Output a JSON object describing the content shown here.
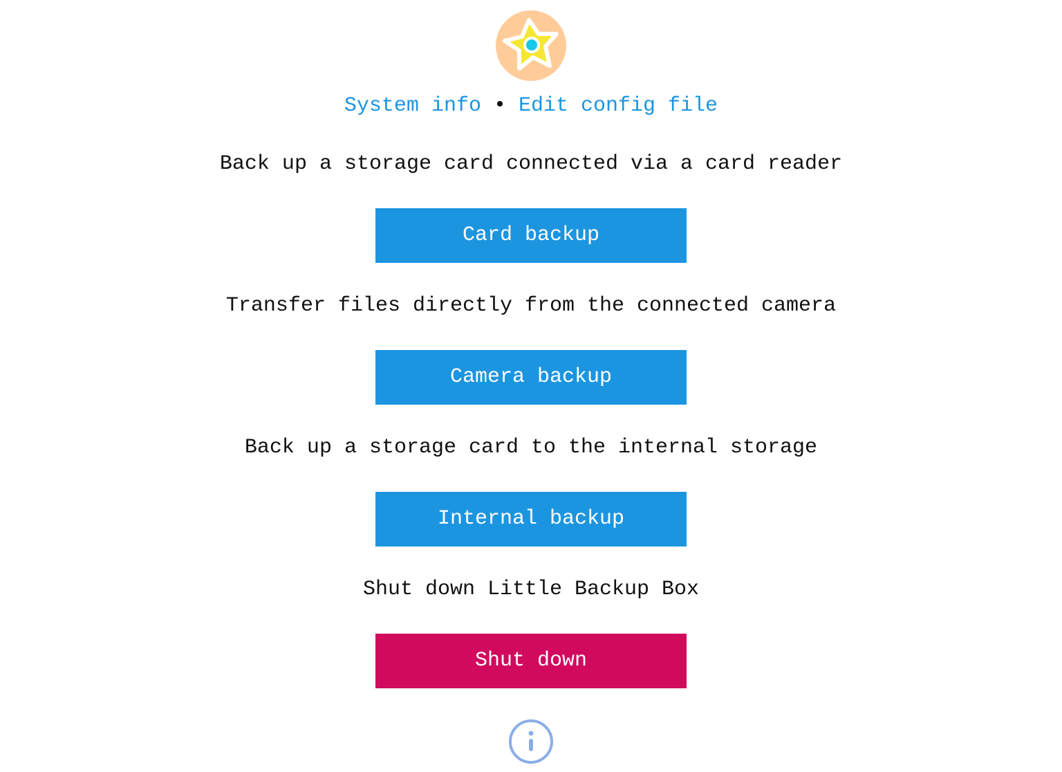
{
  "header": {
    "logo_icon": "starfish-logo-icon",
    "nav": {
      "system_info": "System info",
      "separator": "•",
      "edit_config": "Edit config file"
    }
  },
  "sections": [
    {
      "description": "Back up a storage card connected via a card reader",
      "button_label": "Card backup",
      "button_color": "#1c95e0"
    },
    {
      "description": "Transfer files directly from the connected camera",
      "button_label": "Camera backup",
      "button_color": "#1c95e0"
    },
    {
      "description": "Back up a storage card to the internal storage",
      "button_label": "Internal backup",
      "button_color": "#1c95e0"
    },
    {
      "description": "Shut down Little Backup Box",
      "button_label": "Shut down",
      "button_color": "#d10a5e"
    }
  ],
  "footer": {
    "info_icon": "info-circle-icon"
  },
  "colors": {
    "link": "#1c95e0",
    "primary_button": "#1c95e0",
    "danger_button": "#d10a5e",
    "logo_background": "#ffcc99",
    "logo_star": "#f5e733",
    "logo_eye": "#18c8e8",
    "info_icon": "#8aaee8"
  }
}
